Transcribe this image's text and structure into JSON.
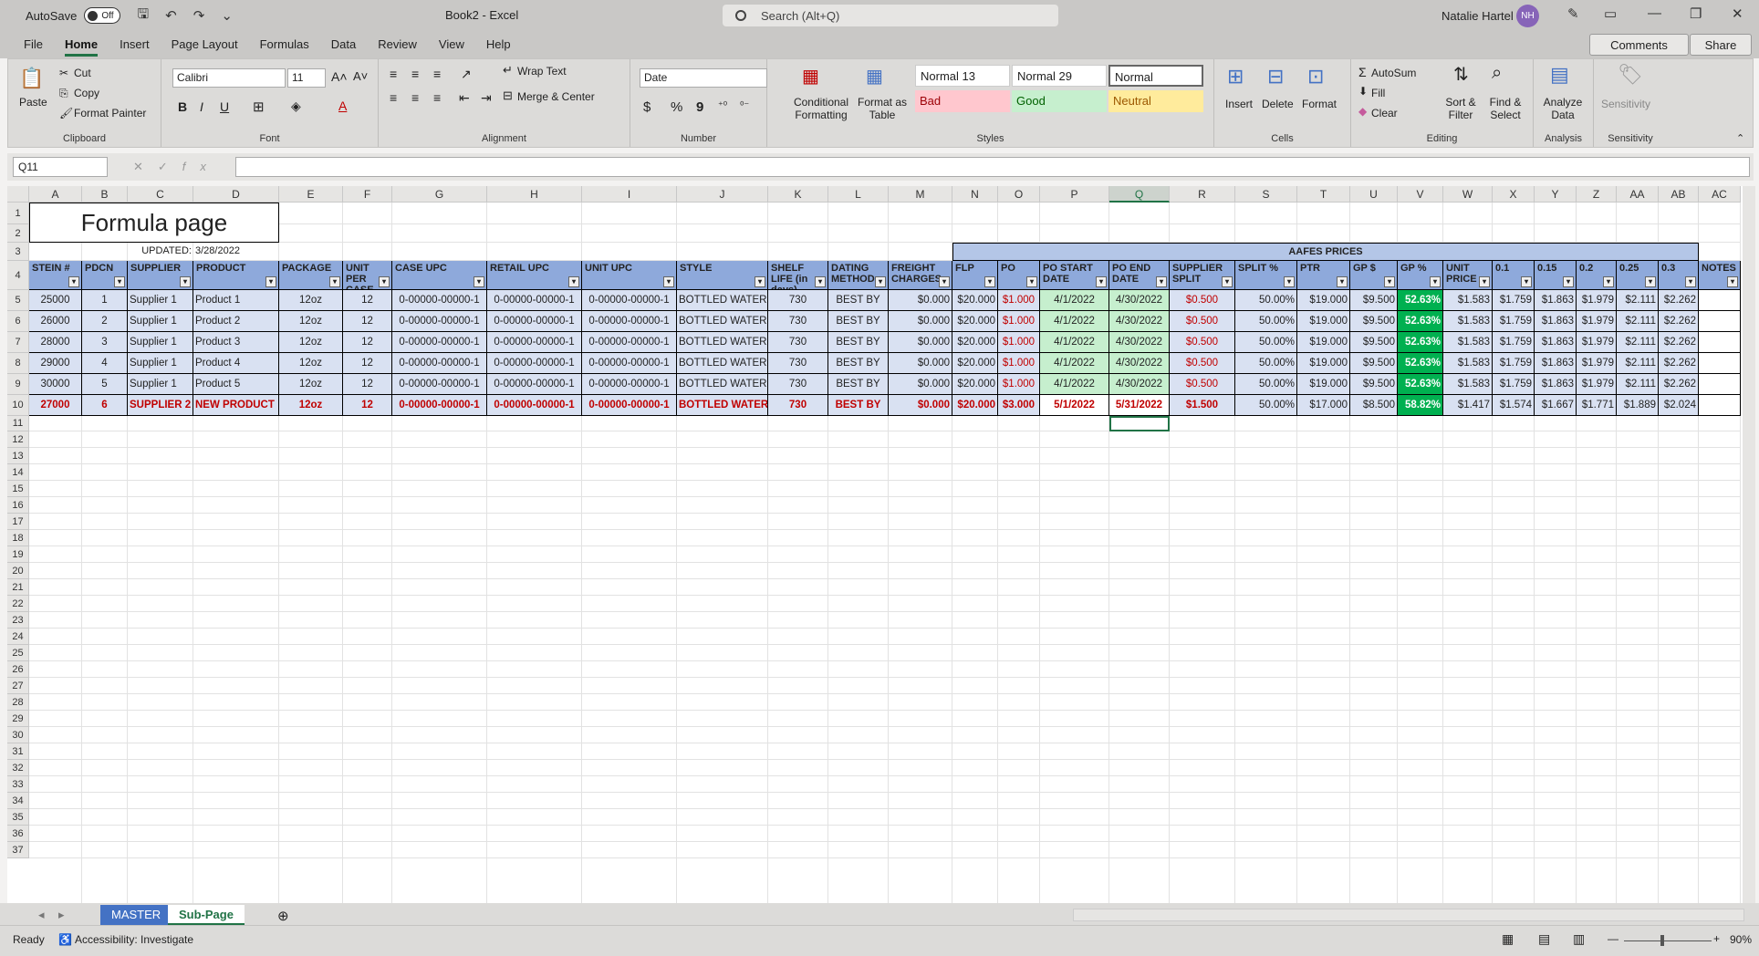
{
  "titlebar": {
    "autosave": "AutoSave",
    "toggle": "Off",
    "title": "Book2  -  Excel",
    "search_placeholder": "Search (Alt+Q)",
    "user": "Natalie Hartel",
    "initials": "NH"
  },
  "tabs": [
    "File",
    "Home",
    "Insert",
    "Page Layout",
    "Formulas",
    "Data",
    "Review",
    "View",
    "Help"
  ],
  "active_tab": "Home",
  "buttons": {
    "comments": "Comments",
    "share": "Share"
  },
  "ribbon": {
    "clipboard": {
      "paste": "Paste",
      "cut": "Cut",
      "copy": "Copy",
      "format_painter": "Format Painter",
      "label": "Clipboard"
    },
    "font": {
      "family": "Calibri",
      "size": "11",
      "bold": "B",
      "italic": "I",
      "underline": "U",
      "label": "Font"
    },
    "alignment": {
      "wrap": "Wrap Text",
      "merge": "Merge & Center",
      "label": "Alignment"
    },
    "number": {
      "format": "Date",
      "currency": "$",
      "percent": "%",
      "comma": "9",
      "label": "Number"
    },
    "styles": {
      "conditional": "Conditional Formatting",
      "format_table": "Format as Table",
      "normal13": "Normal 13",
      "normal29": "Normal 29",
      "normal": "Normal",
      "bad": "Bad",
      "good": "Good",
      "neutral": "Neutral",
      "label": "Styles"
    },
    "cells": {
      "insert": "Insert",
      "delete": "Delete",
      "format": "Format",
      "label": "Cells"
    },
    "editing": {
      "autosum": "AutoSum",
      "fill": "Fill",
      "clear": "Clear",
      "sort": "Sort & Filter",
      "find": "Find & Select",
      "label": "Editing"
    },
    "analysis": {
      "analyze": "Analyze Data",
      "label": "Analysis"
    },
    "sensitivity": {
      "sens": "Sensitivity",
      "label": "Sensitivity"
    }
  },
  "formula_bar": {
    "name_box": "Q11",
    "fx": "fx",
    "value": ""
  },
  "columns": [
    "A",
    "B",
    "C",
    "D",
    "E",
    "F",
    "G",
    "H",
    "I",
    "J",
    "K",
    "L",
    "M",
    "N",
    "O",
    "P",
    "Q",
    "R",
    "S",
    "T",
    "U",
    "V",
    "W",
    "X",
    "Y",
    "Z",
    "AA",
    "AB",
    "AC"
  ],
  "selected_column": "Q",
  "sheet": {
    "title": "Formula page",
    "updated_label": "UPDATED:",
    "updated_date": "3/28/2022",
    "group_header": "AAFES PRICES",
    "headers": [
      "STEIN #",
      "PDCN",
      "SUPPLIER",
      "PRODUCT",
      "PACKAGE",
      "UNIT PER CASE",
      "CASE UPC",
      "RETAIL UPC",
      "UNIT UPC",
      "STYLE",
      "SHELF LIFE (in days)",
      "DATING METHOD",
      "FREIGHT CHARGES",
      "FLP",
      "PO",
      "PO START DATE",
      "PO END DATE",
      "SUPPLIER SPLIT",
      "SPLIT %",
      "PTR",
      "GP $",
      "GP %",
      "UNIT PRICE",
      "0.1",
      "0.15",
      "0.2",
      "0.25",
      "0.3",
      "NOTES"
    ],
    "rows": [
      [
        "25000",
        "1",
        "Supplier 1",
        "Product 1",
        "12oz",
        "12",
        "0-00000-00000-1",
        "0-00000-00000-1",
        "0-00000-00000-1",
        "BOTTLED WATER",
        "730",
        "BEST BY",
        "$0.000",
        "$20.000",
        "$1.000",
        "4/1/2022",
        "4/30/2022",
        "$0.500",
        "50.00%",
        "$19.000",
        "$9.500",
        "52.63%",
        "$1.583",
        "$1.759",
        "$1.863",
        "$1.979",
        "$2.111",
        "$2.262",
        ""
      ],
      [
        "26000",
        "2",
        "Supplier 1",
        "Product 2",
        "12oz",
        "12",
        "0-00000-00000-1",
        "0-00000-00000-1",
        "0-00000-00000-1",
        "BOTTLED WATER",
        "730",
        "BEST BY",
        "$0.000",
        "$20.000",
        "$1.000",
        "4/1/2022",
        "4/30/2022",
        "$0.500",
        "50.00%",
        "$19.000",
        "$9.500",
        "52.63%",
        "$1.583",
        "$1.759",
        "$1.863",
        "$1.979",
        "$2.111",
        "$2.262",
        ""
      ],
      [
        "28000",
        "3",
        "Supplier 1",
        "Product 3",
        "12oz",
        "12",
        "0-00000-00000-1",
        "0-00000-00000-1",
        "0-00000-00000-1",
        "BOTTLED WATER",
        "730",
        "BEST BY",
        "$0.000",
        "$20.000",
        "$1.000",
        "4/1/2022",
        "4/30/2022",
        "$0.500",
        "50.00%",
        "$19.000",
        "$9.500",
        "52.63%",
        "$1.583",
        "$1.759",
        "$1.863",
        "$1.979",
        "$2.111",
        "$2.262",
        ""
      ],
      [
        "29000",
        "4",
        "Supplier 1",
        "Product 4",
        "12oz",
        "12",
        "0-00000-00000-1",
        "0-00000-00000-1",
        "0-00000-00000-1",
        "BOTTLED WATER",
        "730",
        "BEST BY",
        "$0.000",
        "$20.000",
        "$1.000",
        "4/1/2022",
        "4/30/2022",
        "$0.500",
        "50.00%",
        "$19.000",
        "$9.500",
        "52.63%",
        "$1.583",
        "$1.759",
        "$1.863",
        "$1.979",
        "$2.111",
        "$2.262",
        ""
      ],
      [
        "30000",
        "5",
        "Supplier 1",
        "Product 5",
        "12oz",
        "12",
        "0-00000-00000-1",
        "0-00000-00000-1",
        "0-00000-00000-1",
        "BOTTLED WATER",
        "730",
        "BEST BY",
        "$0.000",
        "$20.000",
        "$1.000",
        "4/1/2022",
        "4/30/2022",
        "$0.500",
        "50.00%",
        "$19.000",
        "$9.500",
        "52.63%",
        "$1.583",
        "$1.759",
        "$1.863",
        "$1.979",
        "$2.111",
        "$2.262",
        ""
      ],
      [
        "27000",
        "6",
        "SUPPLIER 2",
        "NEW PRODUCT",
        "12oz",
        "12",
        "0-00000-00000-1",
        "0-00000-00000-1",
        "0-00000-00000-1",
        "BOTTLED WATER",
        "730",
        "BEST BY",
        "$0.000",
        "$20.000",
        "$3.000",
        "5/1/2022",
        "5/31/2022",
        "$1.500",
        "50.00%",
        "$17.000",
        "$8.500",
        "58.82%",
        "$1.417",
        "$1.574",
        "$1.667",
        "$1.771",
        "$1.889",
        "$2.024",
        ""
      ]
    ],
    "row_numbers": [
      "1",
      "2",
      "3",
      "4",
      "5",
      "6",
      "7",
      "8",
      "9",
      "10",
      "11",
      "12",
      "13",
      "14",
      "15",
      "16",
      "17",
      "18",
      "19",
      "20",
      "21",
      "22",
      "23",
      "24",
      "25",
      "26",
      "27",
      "28",
      "29",
      "30",
      "31",
      "32",
      "33",
      "34",
      "35",
      "36",
      "37"
    ]
  },
  "sheet_tabs": [
    "MASTER",
    "Sub-Page"
  ],
  "active_sheet": "Sub-Page",
  "status": {
    "ready": "Ready",
    "accessibility": "Accessibility: Investigate",
    "zoom": "90%"
  },
  "colors": {
    "accent": "#217346",
    "header_blue": "#8ea9db",
    "row_blue": "#d9e1f2",
    "red": "#c00000",
    "green_fill": "#c6efce",
    "gp_green": "#00b050"
  }
}
